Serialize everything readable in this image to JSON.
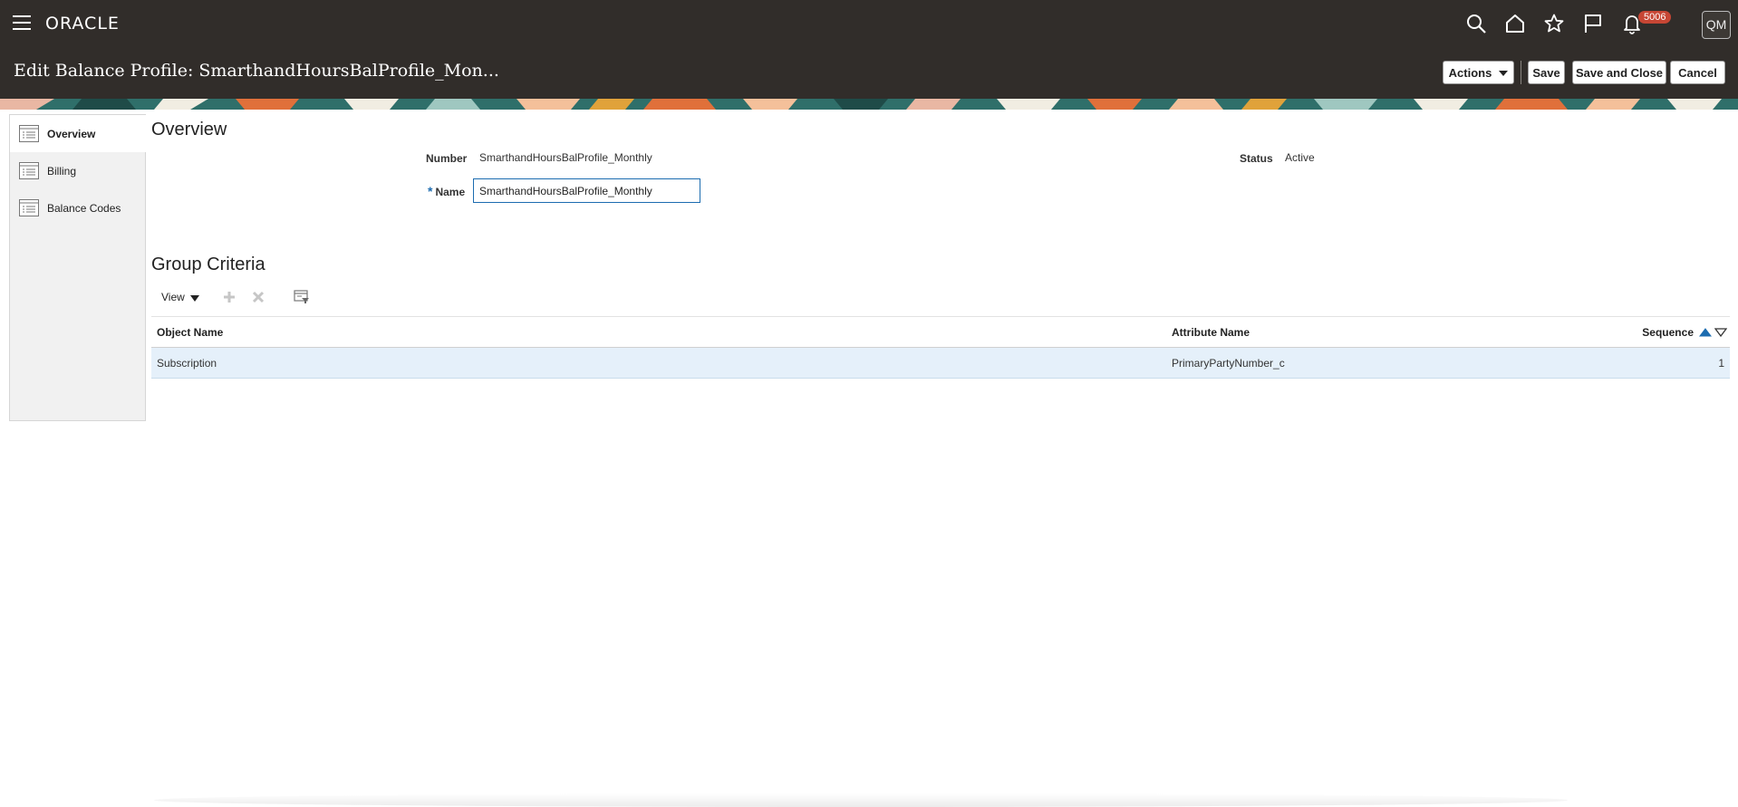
{
  "app": {
    "brand": "ORACLE",
    "notification_count": "5006",
    "user_initials": "QM"
  },
  "header": {
    "title": "Edit Balance Profile: SmarthandHoursBalProfile_Mon...",
    "actions_label": "Actions",
    "save_label": "Save",
    "save_close_label": "Save and Close",
    "cancel_label": "Cancel"
  },
  "nav": {
    "items": [
      {
        "label": "Overview",
        "active": true
      },
      {
        "label": "Billing",
        "active": false
      },
      {
        "label": "Balance Codes",
        "active": false
      }
    ]
  },
  "overview": {
    "title": "Overview",
    "number_label": "Number",
    "number_value": "SmarthandHoursBalProfile_Monthly",
    "status_label": "Status",
    "status_value": "Active",
    "name_label": "Name",
    "name_required": "*",
    "name_value": "SmarthandHoursBalProfile_Monthly"
  },
  "group_criteria": {
    "title": "Group Criteria",
    "view_label": "View",
    "columns": [
      "Object Name",
      "Attribute Name",
      "Sequence"
    ],
    "rows": [
      {
        "object_name": "Subscription",
        "attribute_name": "PrimaryPartyNumber_c",
        "sequence": "1"
      }
    ]
  },
  "colors": {
    "header_bg": "#312d2a",
    "accent_blue": "#1c6cb0",
    "badge_red": "#c74634",
    "selected_row": "#e5f0fa"
  }
}
